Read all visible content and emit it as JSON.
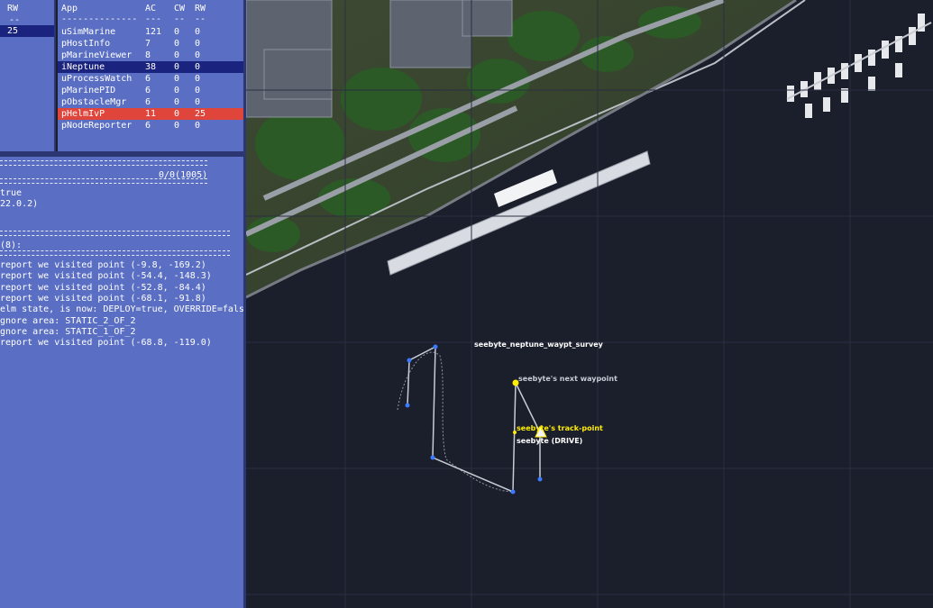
{
  "narrow_pane": {
    "header": "RW",
    "dashes": "--",
    "selected_value": "25"
  },
  "apps_pane": {
    "headers": {
      "app": "App",
      "ac": "AC",
      "cw": "CW",
      "rw": "RW"
    },
    "dashes": {
      "app": "--------------",
      "ac": "---",
      "cw": "--",
      "rw": "--"
    },
    "rows": [
      {
        "app": "uSimMarine",
        "ac": "121",
        "cw": "0",
        "rw": "0",
        "highlight": "none"
      },
      {
        "app": "pHostInfo",
        "ac": "7",
        "cw": "0",
        "rw": "0",
        "highlight": "none"
      },
      {
        "app": "pMarineViewer",
        "ac": "8",
        "cw": "0",
        "rw": "0",
        "highlight": "none"
      },
      {
        "app": "iNeptune",
        "ac": "38",
        "cw": "0",
        "rw": "0",
        "highlight": "blue"
      },
      {
        "app": "uProcessWatch",
        "ac": "6",
        "cw": "0",
        "rw": "0",
        "highlight": "none"
      },
      {
        "app": "pMarinePID",
        "ac": "6",
        "cw": "0",
        "rw": "0",
        "highlight": "none"
      },
      {
        "app": "pObstacleMgr",
        "ac": "6",
        "cw": "0",
        "rw": "0",
        "highlight": "none"
      },
      {
        "app": "pHelmIvP",
        "ac": "11",
        "cw": "0",
        "rw": "25",
        "highlight": "red"
      },
      {
        "app": "pNodeReporter",
        "ac": "6",
        "cw": "0",
        "rw": "0",
        "highlight": "none"
      }
    ]
  },
  "log_pane": {
    "counter": "0/0(1005)",
    "lines_top": [
      "true",
      "22.0.2)"
    ],
    "section_label": "(8):",
    "lines": [
      "report we visited point (-9.8, -169.2)",
      "report we visited point (-54.4, -148.3)",
      "report we visited point (-52.8, -84.4)",
      "report we visited point (-68.1, -91.8)",
      "elm state, is now: DEPLOY=true, OVERRIDE=false",
      "gnore area: STATIC_2_OF_2",
      "gnore area: STATIC_1_OF_2",
      "report we visited point (-68.8, -119.0)"
    ]
  },
  "map": {
    "labels": {
      "survey": "seebyte_neptune_waypt_survey",
      "next_waypoint": "seebyte's next waypoint",
      "track_point": "seebyte's track-point",
      "vehicle": "seebyte (DRIVE)"
    },
    "colors": {
      "pane_bg": "#5a6fc4",
      "selected_blue": "#1a237e",
      "selected_red": "#e0453c",
      "water": "#1b1e2b",
      "waypoint": "#3b7bff",
      "next_waypoint": "#ffee00",
      "track_point": "#ffee00"
    }
  }
}
